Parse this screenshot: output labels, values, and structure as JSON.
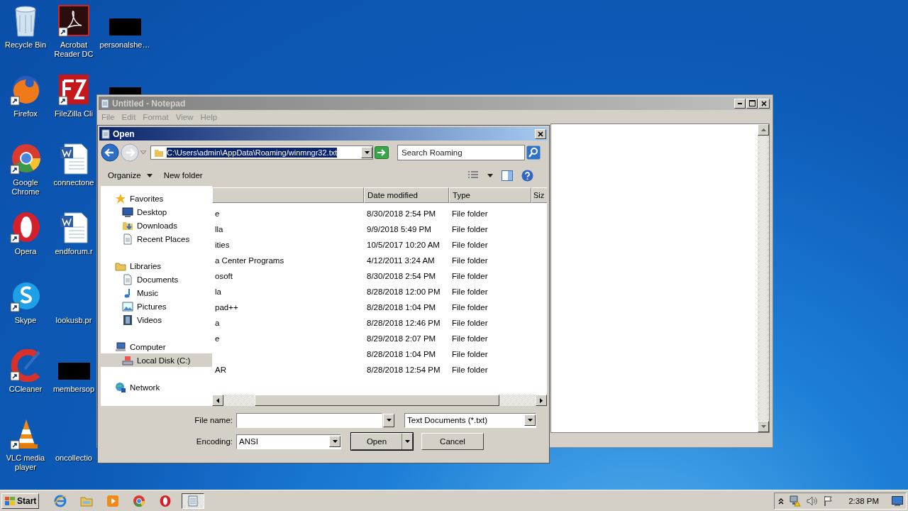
{
  "desktop_icons": [
    {
      "label": "Recycle Bin",
      "kind": "trash"
    },
    {
      "label": "Firefox",
      "kind": "firefox"
    },
    {
      "label": "Google Chrome",
      "kind": "chrome"
    },
    {
      "label": "Opera",
      "kind": "opera"
    },
    {
      "label": "Skype",
      "kind": "skype"
    },
    {
      "label": "CCleaner",
      "kind": "ccleaner"
    },
    {
      "label": "VLC media player",
      "kind": "vlc"
    },
    {
      "label": "Acrobat Reader DC",
      "kind": "acrobat"
    },
    {
      "label": "FileZilla Cli",
      "kind": "filezilla"
    },
    {
      "label": "connectone",
      "kind": "word"
    },
    {
      "label": "endforum.r",
      "kind": "word"
    },
    {
      "label": "lookusb.pr",
      "kind": "blank"
    },
    {
      "label": "membersop",
      "kind": "redacted"
    },
    {
      "label": "oncollectio",
      "kind": "blank"
    },
    {
      "label": "personalshe…",
      "kind": "redacted"
    },
    {
      "kind": "redacted"
    }
  ],
  "notepad": {
    "title": "Untitled - Notepad",
    "menu": [
      "File",
      "Edit",
      "Format",
      "View",
      "Help"
    ]
  },
  "dialog": {
    "title": "Open",
    "address": "C:\\Users\\admin\\AppData\\Roaming/winmngr32.txt",
    "search": {
      "placeholder": "Search Roaming"
    },
    "toolbar": [
      "Organize",
      "New folder"
    ],
    "nav": [
      {
        "label": "Favorites",
        "kind": "star",
        "selected": false,
        "children": [
          {
            "label": "Desktop",
            "kind": "desktop",
            "selected": false
          },
          {
            "label": "Downloads",
            "kind": "downloads",
            "selected": false
          },
          {
            "label": "Recent Places",
            "kind": "recent",
            "selected": false
          }
        ]
      },
      {
        "label": "Libraries",
        "kind": "folder",
        "selected": false,
        "children": [
          {
            "label": "Documents",
            "kind": "document",
            "selected": false
          },
          {
            "label": "Music",
            "kind": "music",
            "selected": false
          },
          {
            "label": "Pictures",
            "kind": "pictures",
            "selected": false
          },
          {
            "label": "Videos",
            "kind": "videos",
            "selected": false
          }
        ]
      },
      {
        "label": "Computer",
        "kind": "computer",
        "selected": false,
        "children": [
          {
            "label": "Local Disk (C:)",
            "kind": "disk",
            "selected": true
          }
        ]
      },
      {
        "label": "Network",
        "kind": "network",
        "selected": false
      }
    ],
    "columns": [
      "Date modified",
      "Type",
      "Siz"
    ],
    "rows": [
      {
        "name": "e",
        "date": "8/30/2018 2:54 PM",
        "type": "File folder"
      },
      {
        "name": "lla",
        "date": "9/9/2018 5:49 PM",
        "type": "File folder"
      },
      {
        "name": "ities",
        "date": "10/5/2017 10:20 AM",
        "type": "File folder"
      },
      {
        "name": "a Center Programs",
        "date": "4/12/2011 3:24 AM",
        "type": "File folder"
      },
      {
        "name": "osoft",
        "date": "8/30/2018 2:54 PM",
        "type": "File folder"
      },
      {
        "name": "la",
        "date": "8/28/2018 12:00 PM",
        "type": "File folder"
      },
      {
        "name": "pad++",
        "date": "8/28/2018 1:04 PM",
        "type": "File folder"
      },
      {
        "name": "a",
        "date": "8/28/2018 12:46 PM",
        "type": "File folder"
      },
      {
        "name": "e",
        "date": "8/29/2018 2:07 PM",
        "type": "File folder"
      },
      {
        "date": "8/28/2018 1:04 PM",
        "type": "File folder"
      },
      {
        "name": "AR",
        "date": "8/28/2018 12:54 PM",
        "type": "File folder"
      }
    ],
    "file_name_label": "File name:",
    "file_type": "Text Documents (*.txt)",
    "encoding_label": "Encoding:",
    "encoding": "ANSI",
    "buttons": [
      "Open",
      "Cancel"
    ]
  },
  "taskbar": {
    "start": "Start",
    "items": [
      {
        "kind": "ie",
        "selected": false
      },
      {
        "kind": "explorer",
        "selected": false
      },
      {
        "kind": "media",
        "selected": false
      },
      {
        "kind": "chrome",
        "selected": false
      },
      {
        "kind": "opera",
        "selected": false
      },
      {
        "kind": "notepad",
        "selected": true
      }
    ],
    "clock": "2:38 PM"
  }
}
